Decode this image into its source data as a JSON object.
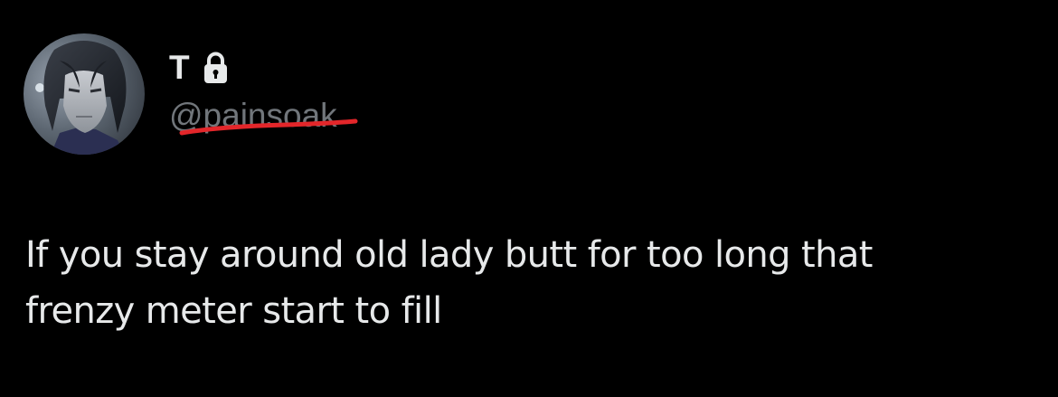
{
  "tweet": {
    "author": {
      "display_name": "T",
      "handle": "@painsoak",
      "protected_icon": "lock-icon",
      "avatar": "profile-avatar"
    },
    "text": "If you stay around old lady butt for too long that\nfrenzy meter start to fill"
  },
  "colors": {
    "background": "#000000",
    "primary_text": "#e7e9ea",
    "secondary_text": "#71767b",
    "redaction_mark": "#e3262a"
  }
}
